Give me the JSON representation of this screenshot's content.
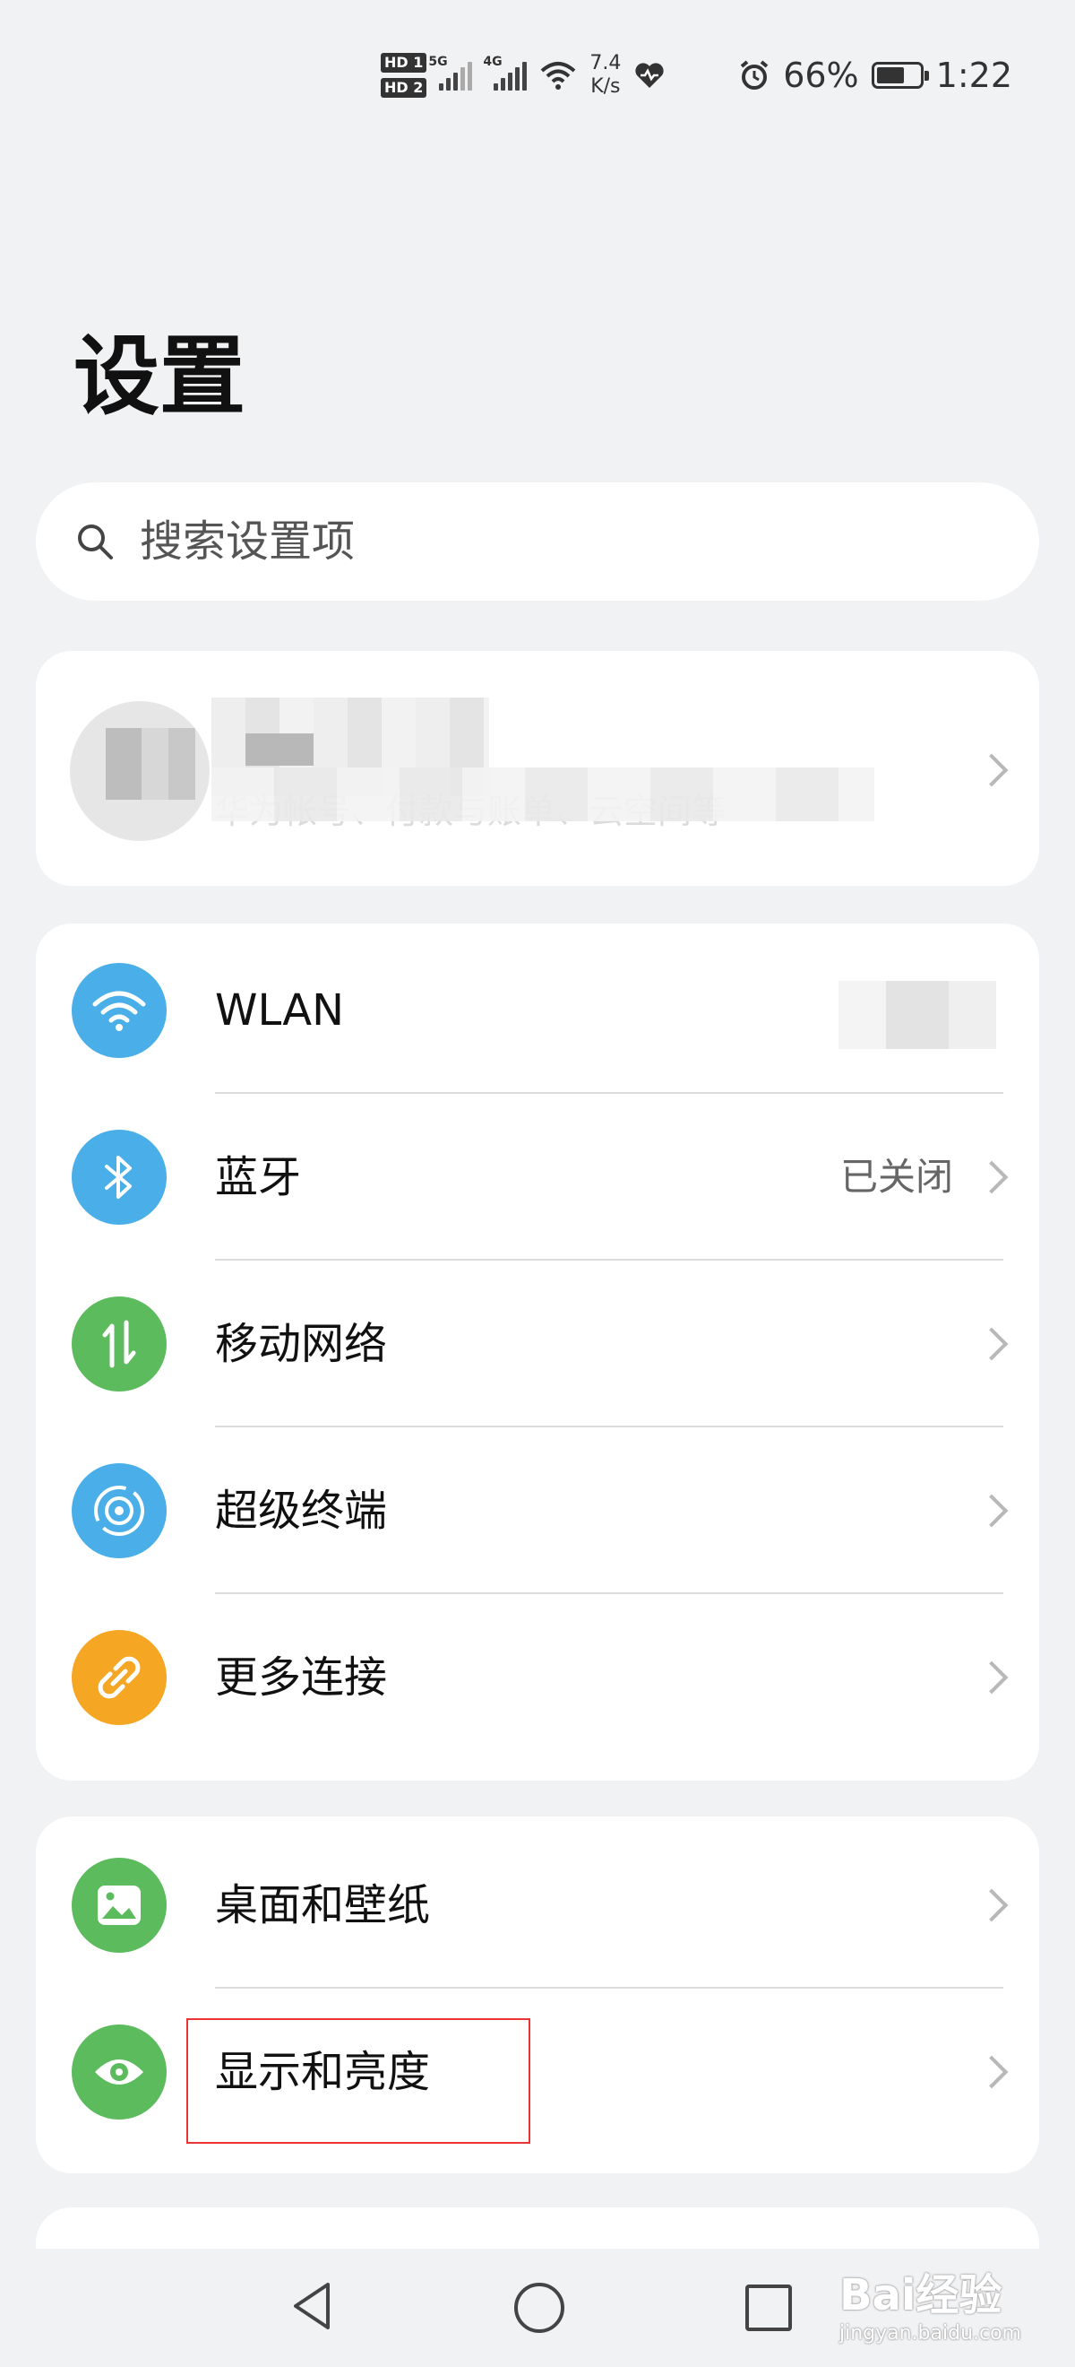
{
  "status_bar": {
    "hd1": "HD 1",
    "hd2": "HD 2",
    "net5g": "5G",
    "net4g": "4G",
    "rate_value": "7.4",
    "rate_unit": "K/s",
    "battery_percent": "66%",
    "battery_level": 0.66,
    "time": "1:22"
  },
  "page": {
    "title": "设置"
  },
  "search": {
    "placeholder": "搜索设置项"
  },
  "account": {
    "subtext": "华为帐号、付款与账单、云空间等"
  },
  "connectivity": {
    "items": [
      {
        "label": "WLAN",
        "value": "",
        "icon": "wifi-icon",
        "color": "#4aaee8"
      },
      {
        "label": "蓝牙",
        "value": "已关闭",
        "icon": "bluetooth-icon",
        "color": "#4aaee8"
      },
      {
        "label": "移动网络",
        "value": "",
        "icon": "mobile-data-icon",
        "color": "#5cbb5c"
      },
      {
        "label": "超级终端",
        "value": "",
        "icon": "super-device-icon",
        "color": "#4aaee8"
      },
      {
        "label": "更多连接",
        "value": "",
        "icon": "link-icon",
        "color": "#f5a623"
      }
    ]
  },
  "display": {
    "items": [
      {
        "label": "桌面和壁纸",
        "icon": "wallpaper-icon",
        "color": "#5cbb5c"
      },
      {
        "label": "显示和亮度",
        "icon": "eye-icon",
        "color": "#5cbb5c"
      }
    ]
  },
  "watermark": {
    "main": "Bai经验",
    "sub": "jingyan.baidu.com"
  }
}
